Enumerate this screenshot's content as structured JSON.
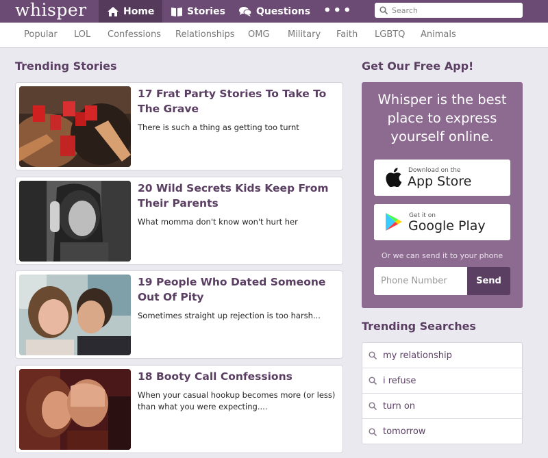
{
  "header": {
    "logo": "whisper",
    "nav": [
      {
        "label": "Home",
        "icon": "home-icon"
      },
      {
        "label": "Stories",
        "icon": "book-icon"
      },
      {
        "label": "Questions",
        "icon": "chat-bubbles-icon"
      }
    ],
    "more": "•••",
    "search_placeholder": "Search"
  },
  "categories": [
    "Popular",
    "LOL",
    "Confessions",
    "Relationships",
    "OMG",
    "Military",
    "Faith",
    "LGBTQ",
    "Animals"
  ],
  "trending_stories": {
    "heading": "Trending Stories",
    "items": [
      {
        "title": "17 Frat Party Stories To Take To The Grave",
        "description": "There is such a thing as getting too turnt"
      },
      {
        "title": "20 Wild Secrets Kids Keep From Their Parents",
        "description": "What momma don't know won't hurt her"
      },
      {
        "title": "19 People Who Dated Someone Out Of Pity",
        "description": "Sometimes straight up rejection is too harsh..."
      },
      {
        "title": "18 Booty Call Confessions",
        "description": "When your casual hookup becomes more (or less) than what you were expecting...."
      }
    ]
  },
  "app_promo": {
    "heading": "Get Our Free App!",
    "tagline": "Whisper is the best place to express yourself online.",
    "app_store": {
      "small": "Download on the",
      "big": "App Store"
    },
    "google_play": {
      "small": "Get it on",
      "big": "Google Play"
    },
    "phone_hint": "Or we can send it to your phone",
    "phone_placeholder": "Phone Number",
    "send_label": "Send"
  },
  "trending_searches": {
    "heading": "Trending Searches",
    "items": [
      "my relationship",
      "i refuse",
      "turn on",
      "tomorrow"
    ]
  },
  "colors": {
    "brand_purple": "#6b4a73",
    "promo_purple": "#8d6a90",
    "heading_purple": "#5a3f63",
    "page_bg": "#ebe9f0"
  }
}
